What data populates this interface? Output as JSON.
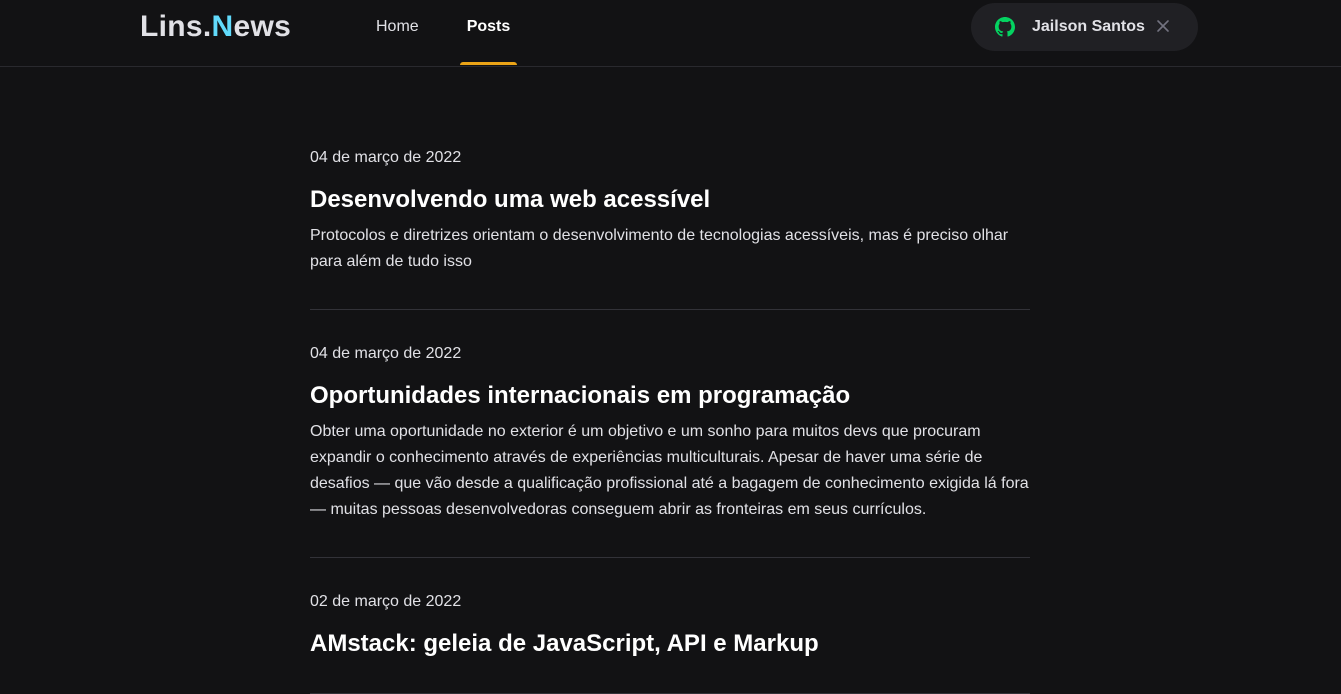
{
  "header": {
    "logo_part1": "Lins.",
    "logo_part2": "N",
    "logo_part3": "ews",
    "nav": [
      {
        "label": "Home",
        "active": false
      },
      {
        "label": "Posts",
        "active": true
      }
    ],
    "user": {
      "name": "Jailson Santos",
      "icon": "github-icon",
      "close_icon": "close-icon"
    }
  },
  "colors": {
    "background": "#121214",
    "accent_logo": "#61dafb",
    "active_underline": "#eba417",
    "github_icon": "#04d361"
  },
  "posts": [
    {
      "date": "04 de março de 2022",
      "title": "Desenvolvendo uma web acessível",
      "excerpt": "Protocolos e diretrizes orientam o desenvolvimento de tecnologias acessíveis, mas é preciso olhar para além de tudo isso"
    },
    {
      "date": "04 de março de 2022",
      "title": "Oportunidades internacionais em programação",
      "excerpt": "Obter uma oportunidade no exterior é um objetivo e um sonho para muitos devs que procuram expandir o conhecimento através de experiências multiculturais. Apesar de haver uma série de desafios — que vão desde a qualificação profissional até a bagagem de conhecimento exigida lá fora — muitas pessoas desenvolvedoras conseguem abrir as fronteiras em seus currículos."
    },
    {
      "date": "02 de março de 2022",
      "title": "AMstack: geleia de JavaScript, API e Markup",
      "excerpt": ""
    }
  ]
}
